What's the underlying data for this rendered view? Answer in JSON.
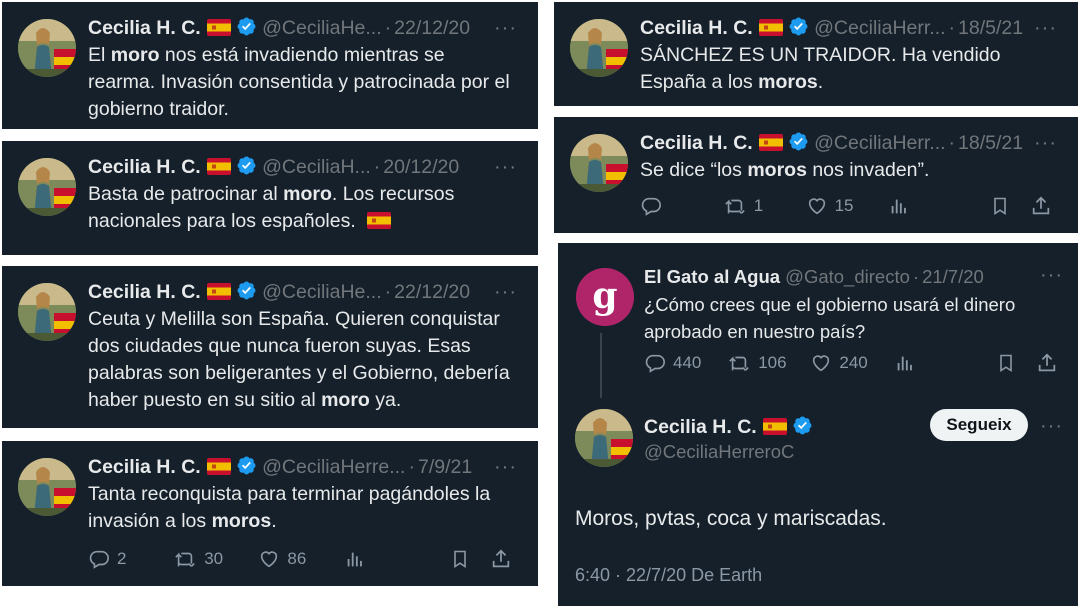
{
  "user": {
    "name": "Cecilia H. C.",
    "handle_full": "@CeciliaHerreroC"
  },
  "tweets": [
    {
      "handle": "@CeciliaHe...",
      "date": "22/12/20",
      "text": [
        {
          "t": "El "
        },
        {
          "t": "moro",
          "b": true
        },
        {
          "t": " nos está invadiendo mientras se rearma. Invasión consentida y patrocinada por el gobierno traidor."
        }
      ]
    },
    {
      "handle": "@CeciliaH...",
      "date": "20/12/20",
      "text": [
        {
          "t": "Basta de patrocinar al "
        },
        {
          "t": "moro",
          "b": true
        },
        {
          "t": ". Los recursos nacionales para los españoles. "
        }
      ],
      "trailing_flag": true
    },
    {
      "handle": "@CeciliaHe...",
      "date": "22/12/20",
      "text": [
        {
          "t": "Ceuta y Melilla son España. Quieren conquistar dos ciudades que nunca fueron suyas. Esas palabras son beligerantes y el Gobierno, debería haber puesto en su sitio al "
        },
        {
          "t": "moro",
          "b": true
        },
        {
          "t": " ya."
        }
      ]
    },
    {
      "handle": "@CeciliaHerre...",
      "date": "7/9/21",
      "text": [
        {
          "t": "Tanta reconquista para terminar pagándoles la invasión a los "
        },
        {
          "t": "moros",
          "b": true
        },
        {
          "t": "."
        }
      ],
      "stats": {
        "replies": "2",
        "retweets": "30",
        "likes": "86"
      }
    },
    {
      "handle": "@CeciliaHerr...",
      "date": "18/5/21",
      "text": [
        {
          "t": "SÁNCHEZ ES UN TRAIDOR. Ha vendido España a los "
        },
        {
          "t": "moros",
          "b": true
        },
        {
          "t": "."
        }
      ]
    },
    {
      "handle": "@CeciliaHerr...",
      "date": "18/5/21",
      "text": [
        {
          "t": "Se dice “los "
        },
        {
          "t": "moros",
          "b": true
        },
        {
          "t": " nos invaden”."
        }
      ],
      "stats": {
        "replies": "",
        "retweets": "1",
        "likes": "15"
      }
    }
  ],
  "thread": {
    "parent": {
      "name": "El Gato al Agua",
      "handle": "@Gato_directo",
      "date": "21/7/20",
      "avatar_letter": "g",
      "avatar_color": "#b0246a",
      "text": "¿Cómo crees que el gobierno usará el dinero aprobado en nuestro país?",
      "stats": {
        "replies": "440",
        "retweets": "106",
        "likes": "240"
      }
    },
    "reply": {
      "follow_label": "Segueix",
      "text": "Moros, pvtas, coca y mariscadas.",
      "timestamp": "6:40 · 22/7/20 De Earth"
    }
  },
  "colors": {
    "card_bg": "#15202b",
    "text": "#e7e9ea",
    "muted": "#71767b",
    "verified": "#1d9bf0"
  }
}
